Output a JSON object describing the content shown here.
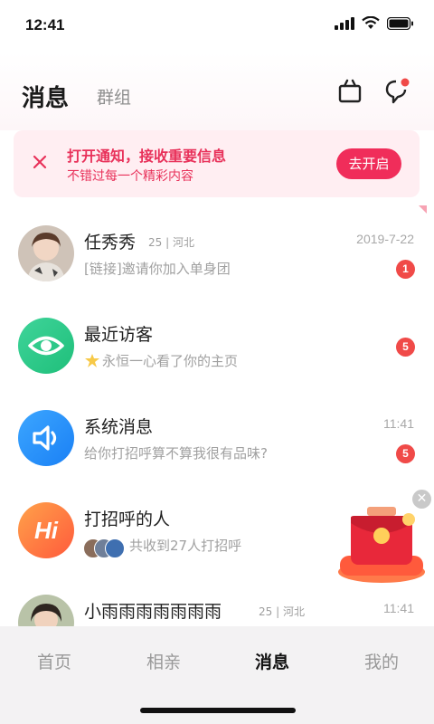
{
  "status": {
    "time": "12:41"
  },
  "header": {
    "title": "消息",
    "subtab": "群组"
  },
  "notice": {
    "title": "打开通知，接收重要信息",
    "subtitle": "不错过每一个精彩内容",
    "button": "去开启"
  },
  "messages": [
    {
      "name": "任秀秀",
      "meta": "25 | 河北",
      "time": "2019-7-22",
      "preview": "[链接]邀请你加入单身团",
      "badge": "1"
    },
    {
      "name": "最近访客",
      "meta": "",
      "time": "",
      "preview": "永恒一心看了你的主页",
      "badge": "5"
    },
    {
      "name": "系统消息",
      "meta": "",
      "time": "11:41",
      "preview": "给你打招呼算不算我很有品味?",
      "badge": "5"
    },
    {
      "name": "打招呼的人",
      "meta": "",
      "time": "",
      "preview": "共收到27人打招呼",
      "badge": ""
    },
    {
      "name": "小雨雨雨雨雨雨雨",
      "meta": "25 | 河北",
      "time": "11:41",
      "preview": "",
      "badge": ""
    }
  ],
  "hi_avatar_text": "Hi",
  "tabs": [
    {
      "label": "首页",
      "active": false
    },
    {
      "label": "相亲",
      "active": false
    },
    {
      "label": "消息",
      "active": true
    },
    {
      "label": "我的",
      "active": false
    }
  ],
  "colors": {
    "accent": "#f02d5a",
    "badge": "#f04a48",
    "notice_bg": "#ffeef2"
  },
  "icons": [
    "signal-icon",
    "wifi-icon",
    "battery-icon",
    "contacts-icon",
    "chat-icon",
    "close-icon",
    "eye-icon",
    "speaker-icon",
    "crown-icon",
    "red-packet-icon"
  ]
}
